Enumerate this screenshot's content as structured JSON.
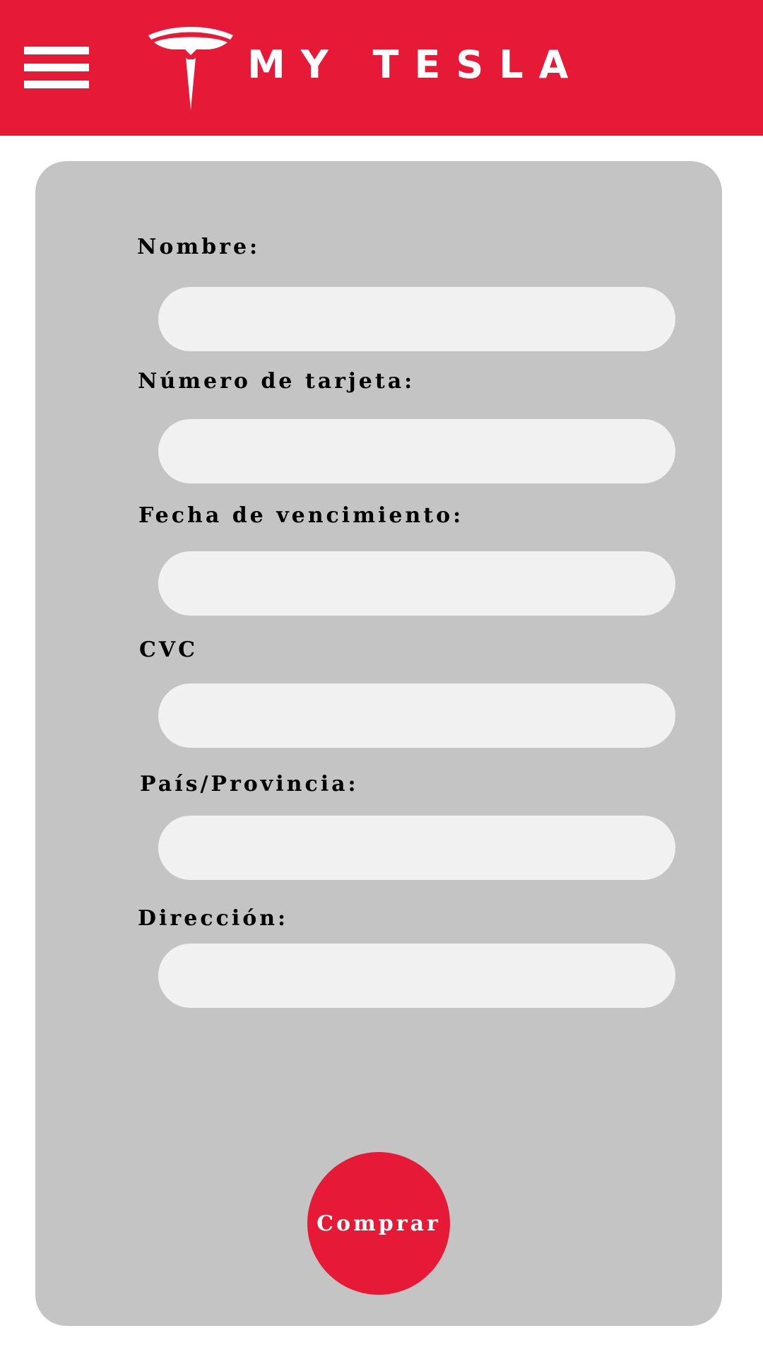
{
  "header": {
    "brand": "MY TESLA",
    "logo_icon": "tesla-t-icon",
    "menu_icon": "hamburger-menu-icon",
    "background_color": "#e61937"
  },
  "form": {
    "background_color": "#c4c4c4",
    "fields": [
      {
        "label": "Nombre:",
        "value": ""
      },
      {
        "label": "Número de tarjeta:",
        "value": ""
      },
      {
        "label": "Fecha de vencimiento:",
        "value": ""
      },
      {
        "label": "CVC",
        "value": ""
      },
      {
        "label": "País/Provincia:",
        "value": ""
      },
      {
        "label": "Dirección:",
        "value": ""
      }
    ],
    "submit_label": "Comprar"
  }
}
